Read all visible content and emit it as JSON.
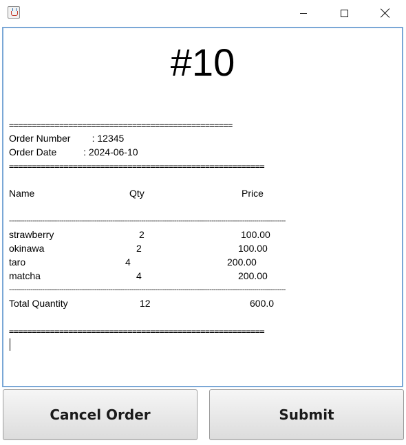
{
  "window": {
    "icon": "java-cup-icon"
  },
  "receipt": {
    "title": "#10",
    "rule_short": "=================================================",
    "order_number_line": "Order Number        : 12345",
    "order_date_line": "Order Date          : 2024-06-10",
    "rule_long": "========================================================",
    "header": {
      "name": "Name",
      "qty": "Qty",
      "price": "Price"
    },
    "dash_rule": "----------------------------------------------------------------------------------------------------------------------------------------------",
    "items": [
      {
        "name": "strawberry",
        "qty": "2",
        "price": "100.00"
      },
      {
        "name": "okinawa",
        "qty": "2",
        "price": "100.00"
      },
      {
        "name": "taro",
        "qty": "4",
        "price": "200.00"
      },
      {
        "name": "matcha",
        "qty": "4",
        "price": "200.00"
      }
    ],
    "total": {
      "label": "Total Quantity",
      "qty": "12",
      "price": "600.0"
    }
  },
  "buttons": {
    "cancel": "Cancel Order",
    "submit": "Submit"
  }
}
